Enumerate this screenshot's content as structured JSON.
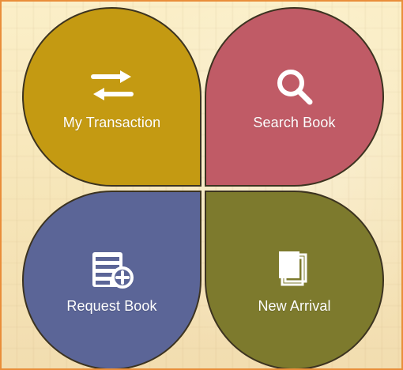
{
  "tiles": {
    "my_transaction": {
      "label": "My Transaction",
      "color": "#c49a12"
    },
    "search_book": {
      "label": "Search Book",
      "color": "#c05b66"
    },
    "request_book": {
      "label": "Request Book",
      "color": "#5b6597"
    },
    "new_arrival": {
      "label": "New Arrival",
      "color": "#7d7a2d"
    }
  },
  "icons": {
    "my_transaction": "swap-arrows-icon",
    "search_book": "search-icon",
    "request_book": "add-document-icon",
    "new_arrival": "stacked-pages-icon"
  },
  "theme": {
    "frame_border": "#e98e3a",
    "petal_border": "#3c3320",
    "text": "#ffffff"
  }
}
